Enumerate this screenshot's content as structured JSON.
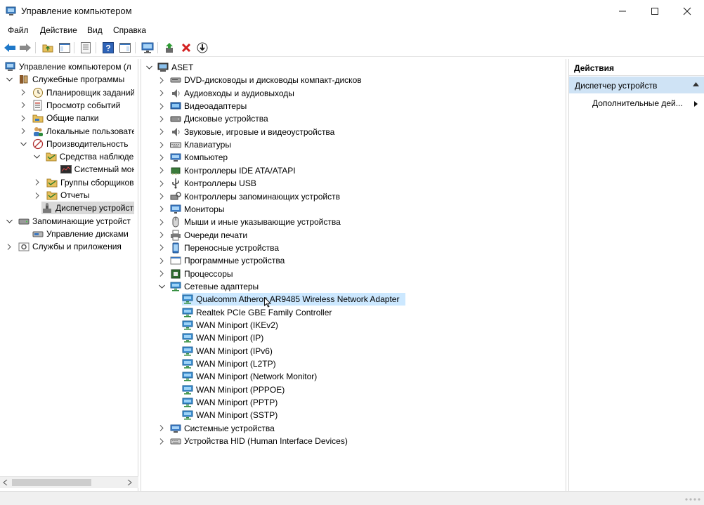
{
  "window": {
    "title": "Управление компьютером",
    "controls": [
      "minimize-icon",
      "maximize-icon",
      "close-icon"
    ]
  },
  "menu": [
    "Файл",
    "Действие",
    "Вид",
    "Справка"
  ],
  "toolbar": {
    "icons": [
      "back-arrow-icon",
      "forward-arrow-icon",
      "folder-up-icon",
      "show-hide-tree-icon",
      "properties-icon",
      "help-icon",
      "show-action-pane-icon",
      "monitor-icon",
      "update-driver-icon",
      "uninstall-icon",
      "disable-device-icon"
    ]
  },
  "left_tree": [
    {
      "label": "Управление компьютером (л",
      "icon": "computer-management-icon",
      "expanded": null
    },
    {
      "label": "Служебные программы",
      "icon": "tools-icon",
      "expanded": true
    },
    {
      "label": "Планировщик заданий",
      "icon": "clock-icon",
      "expanded": false
    },
    {
      "label": "Просмотр событий",
      "icon": "event-viewer-icon",
      "expanded": false
    },
    {
      "label": "Общие папки",
      "icon": "shared-folder-icon",
      "expanded": false
    },
    {
      "label": "Локальные пользовате",
      "icon": "users-icon",
      "expanded": false
    },
    {
      "label": "Производительность",
      "icon": "performance-icon",
      "expanded": true
    },
    {
      "label": "Средства наблюдени",
      "icon": "folder-icon",
      "expanded": true
    },
    {
      "label": "Системный мон",
      "icon": "monitor-graph-icon",
      "expanded": null
    },
    {
      "label": "Группы сборщиков",
      "icon": "folder-icon",
      "expanded": false
    },
    {
      "label": "Отчеты",
      "icon": "folder-icon",
      "expanded": false
    },
    {
      "label": "Диспетчер устройств",
      "icon": "device-manager-icon",
      "expanded": null,
      "selected": true
    },
    {
      "label": "Запоминающие устройст",
      "icon": "storage-icon",
      "expanded": true
    },
    {
      "label": "Управление дисками",
      "icon": "disk-management-icon",
      "expanded": null
    },
    {
      "label": "Службы и приложения",
      "icon": "services-icon",
      "expanded": false
    }
  ],
  "device_tree": {
    "root": "ASET",
    "categories": [
      {
        "label": "DVD-дисководы и дисководы компакт-дисков",
        "icon": "dvd-drive-icon"
      },
      {
        "label": "Аудиовходы и аудиовыходы",
        "icon": "speaker-icon"
      },
      {
        "label": "Видеоадаптеры",
        "icon": "display-adapter-icon"
      },
      {
        "label": "Дисковые устройства",
        "icon": "disk-drive-icon"
      },
      {
        "label": "Звуковые, игровые и видеоустройства",
        "icon": "speaker-icon"
      },
      {
        "label": "Клавиатуры",
        "icon": "keyboard-icon"
      },
      {
        "label": "Компьютер",
        "icon": "computer-icon"
      },
      {
        "label": "Контроллеры IDE ATA/ATAPI",
        "icon": "ide-controller-icon"
      },
      {
        "label": "Контроллеры USB",
        "icon": "usb-icon"
      },
      {
        "label": "Контроллеры запоминающих устройств",
        "icon": "storage-controller-icon"
      },
      {
        "label": "Мониторы",
        "icon": "monitor-icon"
      },
      {
        "label": "Мыши и иные указывающие устройства",
        "icon": "mouse-icon"
      },
      {
        "label": "Очереди печати",
        "icon": "printer-icon"
      },
      {
        "label": "Переносные устройства",
        "icon": "portable-device-icon"
      },
      {
        "label": "Программные устройства",
        "icon": "software-device-icon"
      },
      {
        "label": "Процессоры",
        "icon": "processor-icon"
      }
    ],
    "network": {
      "label": "Сетевые адаптеры",
      "icon": "network-adapter-icon",
      "adapters": [
        "Qualcomm Atheros AR9485 Wireless Network Adapter",
        "Realtek PCIe GBE Family Controller",
        "WAN Miniport (IKEv2)",
        "WAN Miniport (IP)",
        "WAN Miniport (IPv6)",
        "WAN Miniport (L2TP)",
        "WAN Miniport (Network Monitor)",
        "WAN Miniport (PPPOE)",
        "WAN Miniport (PPTP)",
        "WAN Miniport (SSTP)"
      ]
    },
    "after": [
      {
        "label": "Системные устройства",
        "icon": "system-device-icon"
      },
      {
        "label": "Устройства HID (Human Interface Devices)",
        "icon": "hid-icon"
      }
    ]
  },
  "actions": {
    "header": "Действия",
    "group": "Диспетчер устройств",
    "item": "Дополнительные дей..."
  }
}
